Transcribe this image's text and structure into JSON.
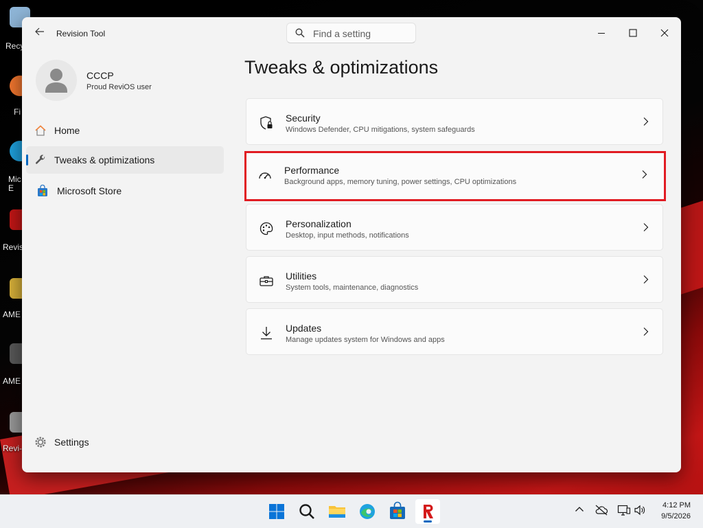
{
  "desktop": {
    "icons": [
      {
        "label": "Recy",
        "color": "#8fb6d8"
      },
      {
        "label": "Fi",
        "color": "#f4772f"
      },
      {
        "label": "Mic E",
        "color": "#1fa2df"
      },
      {
        "label": "Revis",
        "color": "#c41616"
      },
      {
        "label": "AME",
        "color": "#d9b23a"
      },
      {
        "label": "AME",
        "color": "#5a5a5a"
      },
      {
        "label": "Revi-",
        "color": "#9a9a9a"
      }
    ]
  },
  "window": {
    "title": "Revision Tool",
    "search": {
      "placeholder": "Find a setting",
      "value": ""
    }
  },
  "profile": {
    "name": "CCCP",
    "subtitle": "Proud ReviOS user"
  },
  "sidebar": {
    "items": [
      {
        "label": "Home",
        "icon": "home-icon",
        "active": false
      },
      {
        "label": "Tweaks & optimizations",
        "icon": "wrench-icon",
        "active": true
      },
      {
        "label": "Microsoft Store",
        "icon": "store-icon",
        "active": false
      }
    ],
    "settings_label": "Settings"
  },
  "main": {
    "title": "Tweaks & optimizations",
    "cards": [
      {
        "title": "Security",
        "description": "Windows Defender, CPU mitigations, system safeguards",
        "icon": "shield-lock-icon",
        "highlighted": false
      },
      {
        "title": "Performance",
        "description": "Background apps, memory tuning, power settings, CPU optimizations",
        "icon": "speedometer-icon",
        "highlighted": true
      },
      {
        "title": "Personalization",
        "description": "Desktop, input methods, notifications",
        "icon": "palette-icon",
        "highlighted": false
      },
      {
        "title": "Utilities",
        "description": "System tools, maintenance, diagnostics",
        "icon": "toolbox-icon",
        "highlighted": false
      },
      {
        "title": "Updates",
        "description": "Manage updates system for Windows and apps",
        "icon": "download-arrow-icon",
        "highlighted": false
      }
    ]
  },
  "taskbar": {
    "apps": [
      "start-icon",
      "search-icon",
      "file-explorer-icon",
      "edge-icon",
      "microsoft-store-icon",
      "revision-tool-icon"
    ],
    "active_app": "revision-tool-icon",
    "clock": {
      "time": "4:12 PM",
      "date": "9/5/2026"
    }
  },
  "colors": {
    "accent": "#0067c0",
    "highlight_border": "#e11b22",
    "window_bg": "#f3f3f3",
    "card_bg": "#fbfbfb"
  }
}
